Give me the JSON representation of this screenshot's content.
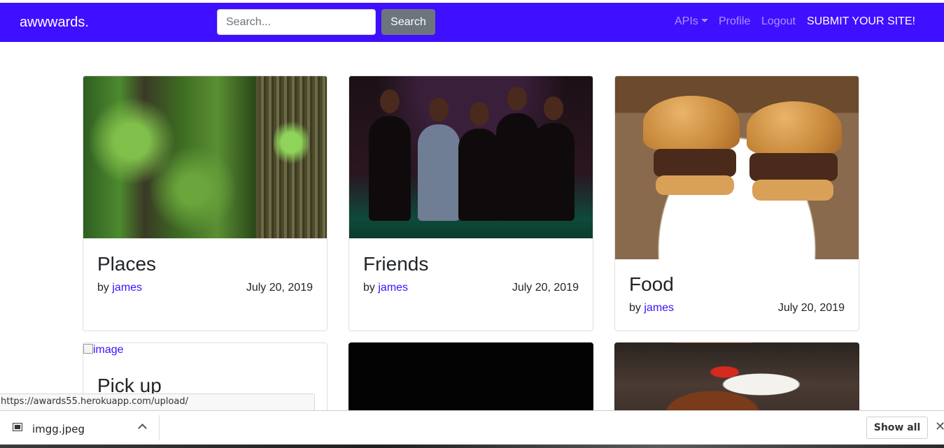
{
  "navbar": {
    "brand": "awwwards.",
    "search": {
      "placeholder": "Search...",
      "value": "",
      "button_label": "Search"
    },
    "links": {
      "apis": "APIs",
      "profile": "Profile",
      "logout": "Logout",
      "submit": "SUBMIT YOUR SITE!"
    },
    "background_color": "#3f0fff"
  },
  "cards": [
    {
      "title": "Places",
      "by": "by",
      "author": "james",
      "date": "July 20, 2019"
    },
    {
      "title": "Friends",
      "by": "by",
      "author": "james",
      "date": "July 20, 2019"
    },
    {
      "title": "Food",
      "by": "by",
      "author": "james",
      "date": "July 20, 2019"
    },
    {
      "title": "Pick up",
      "image_alt": "image"
    }
  ],
  "status_bar": {
    "url": "https://awards55.herokuapp.com/upload/"
  },
  "download_bar": {
    "file_name": "imgg.jpeg",
    "show_all_label": "Show all",
    "close_glyph": "✕"
  },
  "icons": [
    "caret-down-icon",
    "file-icon",
    "chevron-up-icon",
    "close-icon",
    "broken-image-icon"
  ]
}
